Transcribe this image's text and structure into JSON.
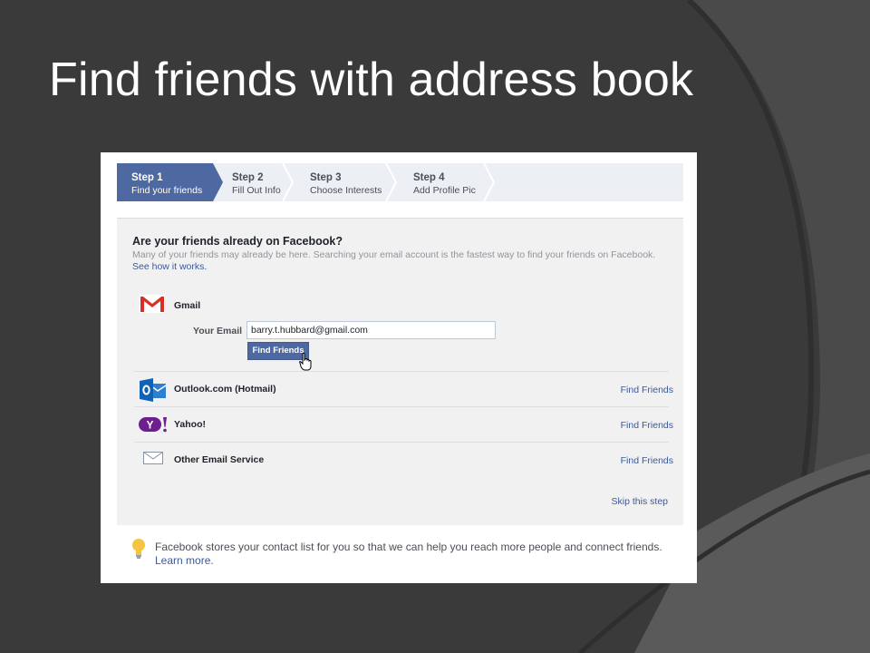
{
  "slide": {
    "title": "Find friends with address book"
  },
  "steps": [
    {
      "label": "Step 1",
      "sub": "Find your friends",
      "active": true
    },
    {
      "label": "Step 2",
      "sub": "Fill Out Info",
      "active": false
    },
    {
      "label": "Step 3",
      "sub": "Choose Interests",
      "active": false
    },
    {
      "label": "Step 4",
      "sub": "Add Profile Pic",
      "active": false
    }
  ],
  "panel": {
    "heading": "Are your friends already on Facebook?",
    "description": "Many of your friends may already be here. Searching your email account is the fastest way to find your friends on Facebook.",
    "see_how_link": "See how it works."
  },
  "gmail": {
    "name": "Gmail",
    "email_label": "Your Email",
    "email_value": "barry.t.hubbard@gmail.com",
    "button_label": "Find Friends"
  },
  "providers": [
    {
      "name": "Outlook.com (Hotmail)",
      "action": "Find Friends"
    },
    {
      "name": "Yahoo!",
      "action": "Find Friends"
    },
    {
      "name": "Other Email Service",
      "action": "Find Friends"
    }
  ],
  "skip_link": "Skip this step",
  "footer": {
    "note": "Facebook stores your contact list for you so that we can help you reach more people and connect friends.",
    "learn_more": "Learn more."
  },
  "colors": {
    "background": "#3a3a3a",
    "facebook_blue": "#3b5998",
    "active_step": "#4e69a2",
    "panel": "#f1f1f1"
  },
  "icons": {
    "gmail": "gmail-icon",
    "outlook": "outlook-icon",
    "yahoo": "yahoo-icon",
    "other_email": "envelope-icon",
    "tip": "lightbulb-icon",
    "cursor": "hand-cursor-icon"
  }
}
